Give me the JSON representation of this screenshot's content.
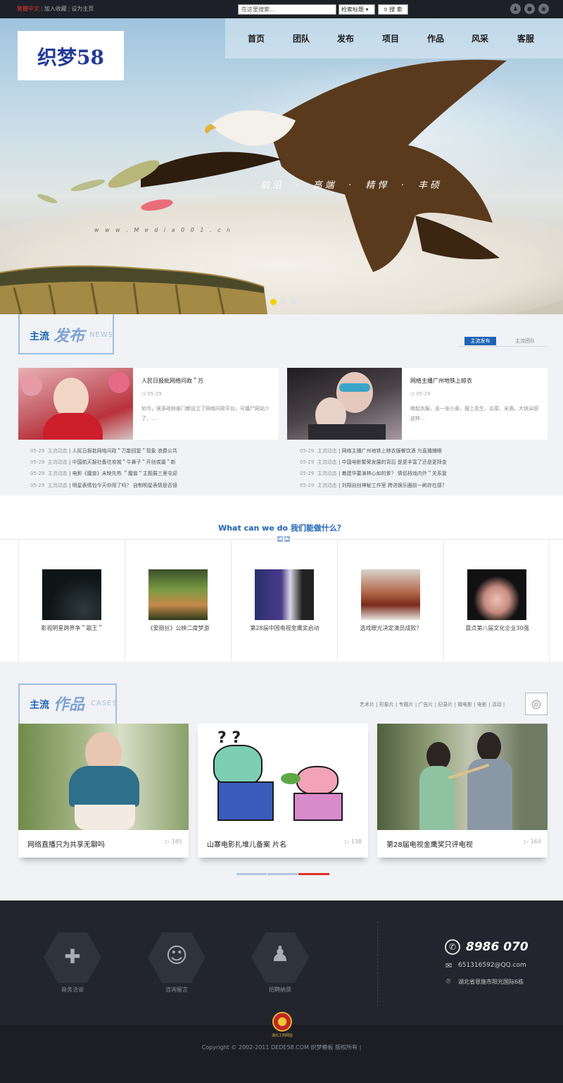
{
  "topbar": {
    "lang": "繁體中文",
    "links": [
      "加入收藏",
      "设为主页"
    ],
    "search_placeholder": "在这里搜索...",
    "search_select": "检索标题",
    "search_button": "搜 索"
  },
  "header": {
    "logo": "织梦58",
    "nav": [
      "首页",
      "团队",
      "发布",
      "项目",
      "作品",
      "风采",
      "客服"
    ]
  },
  "hero": {
    "tagline": "前沿  ·  高端  ·  精悍  ·  丰硕",
    "watermark": "w w w . M e d i a 0 0 1 . c n",
    "dots": 3
  },
  "news": {
    "title": "主流",
    "title_script": "发布",
    "title_en": "NEWS",
    "tabs": [
      "主流发布",
      "主流团队"
    ],
    "cards": [
      {
        "title": "人民日报批网络问政＂万",
        "date": "05-29",
        "summary": "如今，很多政府部门都设立了网络问政平台。可僵尸网站少了，..."
      },
      {
        "title": "网络主播广州地铁上晾衣",
        "date": "05-29",
        "summary": "晾起衣服，支一张小桌，摆上花生、瓜菜、米酒，大快朵颐这样..."
      }
    ],
    "left_list": [
      {
        "date": "05-29",
        "cat": "主流动态",
        "title": "人民日报批网络问政＂万能回复＂现象 浪费公共"
      },
      {
        "date": "05-29",
        "cat": "主流动态",
        "title": "中国航天报社备往攻城＂牛鼻子＂开创或瀛＂新"
      },
      {
        "date": "05-29",
        "cat": "主流动态",
        "title": "电影《魔兽》未映先热 ＂魔兽＂主题展三里屯迎"
      },
      {
        "date": "05-29",
        "cat": "主流动态",
        "title": "明星表情包今天你用了吗？ 自制明星表情是否侵"
      }
    ],
    "right_list": [
      {
        "date": "05-29",
        "cat": "主流动态",
        "title": "网络主播广州地铁上晾衣服餐饮酒 为直播捕眼"
      },
      {
        "date": "05-29",
        "cat": "主流动态",
        "title": "中国电影繁荣发展的背后 是更丰富了还是更拜金"
      },
      {
        "date": "05-29",
        "cat": "主流动态",
        "title": "着建华要演林心如的爹？ 情侣档戏内外＂关系复"
      },
      {
        "date": "05-29",
        "cat": "主流动态",
        "title": "刘翔自创神秘工作室 跨进娱乐圈前一刷存在感？"
      }
    ]
  },
  "what_we_do": {
    "title": "What can we do 我们能做什么？",
    "items": [
      {
        "caption": "影视明星跨界争＂歌王＂"
      },
      {
        "caption": "《爱丽丝》公映二度梦游"
      },
      {
        "caption": "第28届中国电视金鹰奖启动"
      },
      {
        "caption": "选戏眼光决定演员成败？"
      },
      {
        "caption": "盘点第八届文化企业30强"
      }
    ]
  },
  "works": {
    "title": "主流",
    "title_script": "作品",
    "title_en": "CASES",
    "categories": [
      "艺术片",
      "形象片",
      "专题片",
      "广告片",
      "纪录片",
      "微电影",
      "电影",
      "活动"
    ],
    "items": [
      {
        "caption": "网络直播只为共享无聊吗",
        "count": "185"
      },
      {
        "caption": "山寨电影扎堆儿备案 片名",
        "count": "138"
      },
      {
        "caption": "第28届电视金鹰奖只评电视",
        "count": "164"
      }
    ]
  },
  "footer": {
    "services": [
      "商务洽谈",
      "咨询留言",
      "招聘纳贤"
    ],
    "phone": "8986 070",
    "email": "651316592@QQ.com",
    "address": "湖北省恩施市阳光国际6栋",
    "badge_text": "湖北工商网监",
    "copyright": "Copyright © 2002-2011 DEDE58.COM 织梦模板 版权所有 |"
  }
}
